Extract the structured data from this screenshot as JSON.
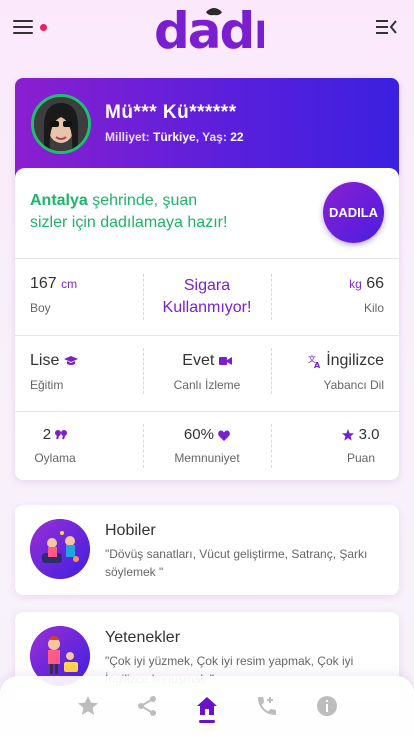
{
  "topbar": {
    "logo_text": "dadı",
    "brand_color": "#7a1fcf",
    "notification_color": "#e91e63"
  },
  "profile": {
    "name": "Mü*** Kü******",
    "nationality_label": "Milliyet:",
    "nationality": "Türkiye",
    "age_label": "Yaş:",
    "age": "22"
  },
  "ready": {
    "city": "Antalya",
    "text_line1": " şehrinde, şuan",
    "text_line2": "sizler için dadılamaya hazır!",
    "button_label": "DADILA"
  },
  "stats_row1": {
    "height_value": "167",
    "height_unit": "cm",
    "height_label": "Boy",
    "smoking_line1": "Sigara",
    "smoking_line2": "Kullanmıyor!",
    "weight_unit": "kg",
    "weight_value": "66",
    "weight_label": "Kilo"
  },
  "stats_row2": {
    "education_value": "Lise",
    "education_label": "Eğitim",
    "live_value": "Evet",
    "live_label": "Canlı İzleme",
    "language_value": "İngilizce",
    "language_label": "Yabancı Dil"
  },
  "stats_row3": {
    "votes_value": "2",
    "votes_label": "Oylama",
    "satisfaction_value": "60%",
    "satisfaction_label": "Memnuniyet",
    "score_value": "3.0",
    "score_label": "Puan"
  },
  "hobbies": {
    "title": "Hobiler",
    "desc": "\"Dövüş sanatları, Vücut geliştirme, Satranç, Şarkı söylemek \""
  },
  "skills": {
    "title": "Yetenekler",
    "desc": "\"Çok iyi yüzmek, Çok iyi resim yapmak, Çok iyi İngilizce konuşmak \""
  },
  "bottom_nav": {
    "items": [
      "star-icon",
      "share-icon",
      "home-icon",
      "phone-icon",
      "info-icon"
    ],
    "active": "home-icon",
    "active_color": "#6a12c9",
    "inactive_color": "#bdbdbd"
  }
}
